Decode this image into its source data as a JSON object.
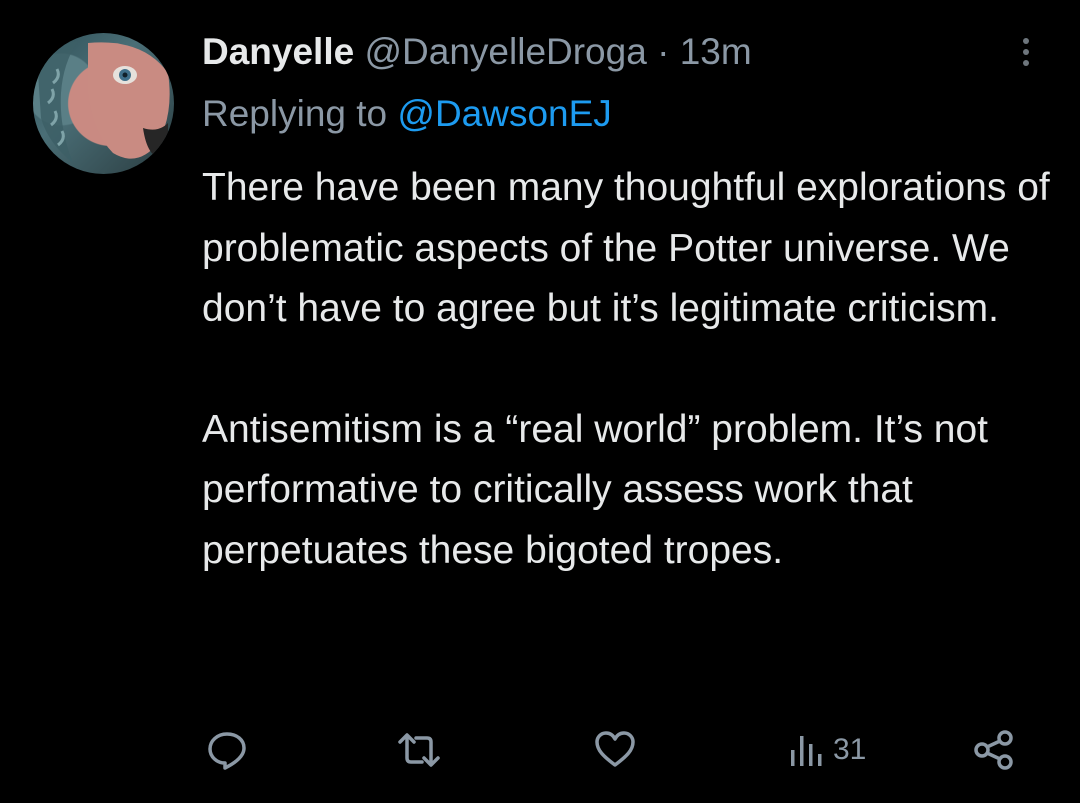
{
  "tweet": {
    "author": {
      "display_name": "Danyelle",
      "handle": "@DanyelleDroga"
    },
    "separator": "·",
    "time": "13m",
    "reply_prefix": "Replying to",
    "reply_to": "@DawsonEJ",
    "paragraphs": [
      "There have been many thoughtful explorations of problematic aspects of the Potter universe. We don’t have to agree but it’s legitimate criticism.",
      "Antisemitism is a “real world” problem. It’s not performative to critically assess work that perpetuates these bigoted tropes."
    ]
  },
  "actions": {
    "views_count": "31"
  },
  "icons": {
    "more": "more-vertical-icon",
    "reply": "reply-icon",
    "retweet": "retweet-icon",
    "like": "heart-icon",
    "views": "analytics-icon",
    "share": "share-icon"
  },
  "colors": {
    "background": "#000000",
    "text": "#e7e9ea",
    "secondary": "#8b98a5",
    "link": "#1d9bf0"
  }
}
